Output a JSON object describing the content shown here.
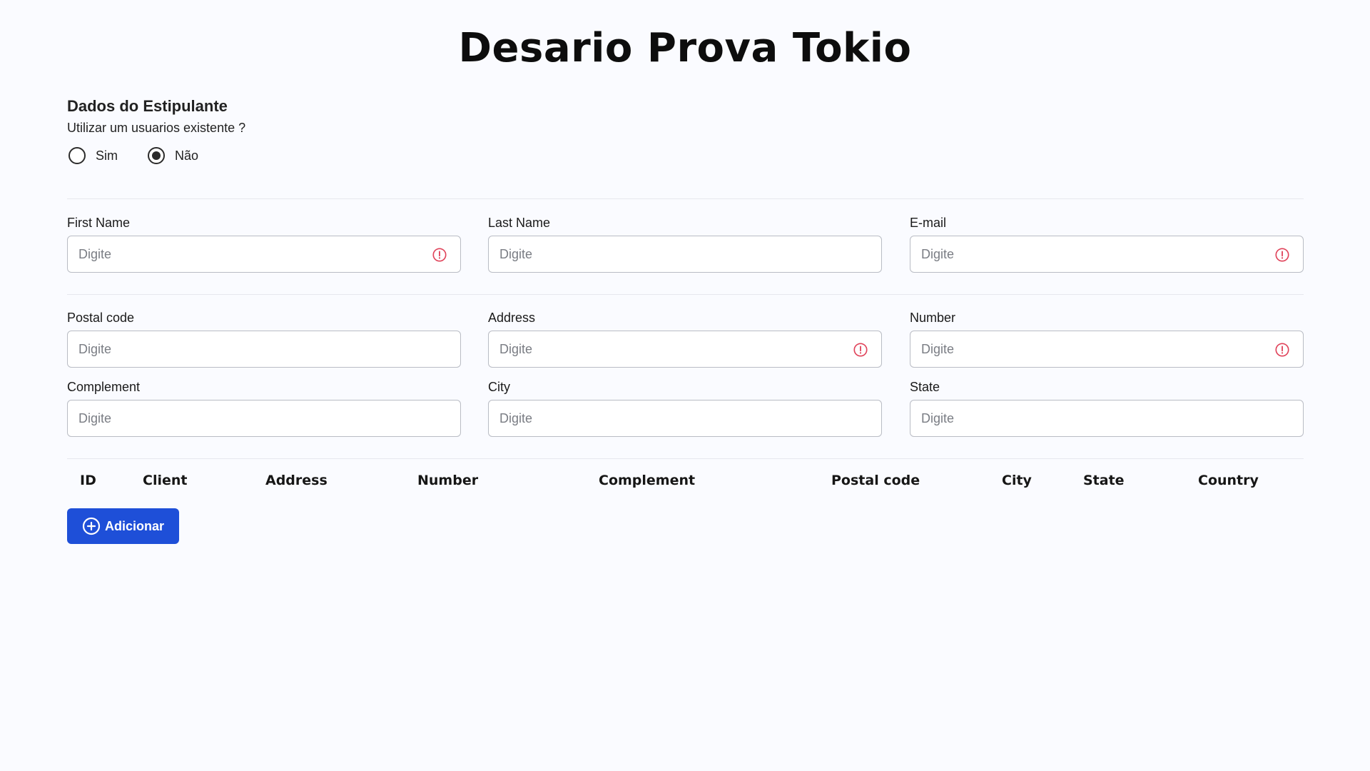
{
  "title": "Desario Prova Tokio",
  "section": {
    "title": "Dados do Estipulante",
    "question": "Utilizar um usuarios existente ?",
    "options": [
      {
        "label": "Sim",
        "selected": false
      },
      {
        "label": "Não",
        "selected": true
      }
    ]
  },
  "form": {
    "placeholder": "Digite",
    "alert_color": "#e0435a",
    "fields": {
      "first_name": {
        "label": "First Name",
        "value": "",
        "error": true
      },
      "last_name": {
        "label": "Last Name",
        "value": "",
        "error": false
      },
      "email": {
        "label": "E-mail",
        "value": "",
        "error": true
      },
      "postal_code": {
        "label": "Postal code",
        "value": "",
        "error": false
      },
      "address": {
        "label": "Address",
        "value": "",
        "error": true
      },
      "number": {
        "label": "Number",
        "value": "",
        "error": true
      },
      "complement": {
        "label": "Complement",
        "value": "",
        "error": false
      },
      "city": {
        "label": "City",
        "value": "",
        "error": false
      },
      "state": {
        "label": "State",
        "value": "",
        "error": false
      }
    }
  },
  "table": {
    "columns": [
      "ID",
      "Client",
      "Address",
      "Number",
      "Complement",
      "Postal code",
      "City",
      "State",
      "Country"
    ],
    "rows": []
  },
  "add_button": {
    "label": "Adicionar",
    "icon": "plus-circle-icon",
    "color": "#1e4fd8"
  }
}
